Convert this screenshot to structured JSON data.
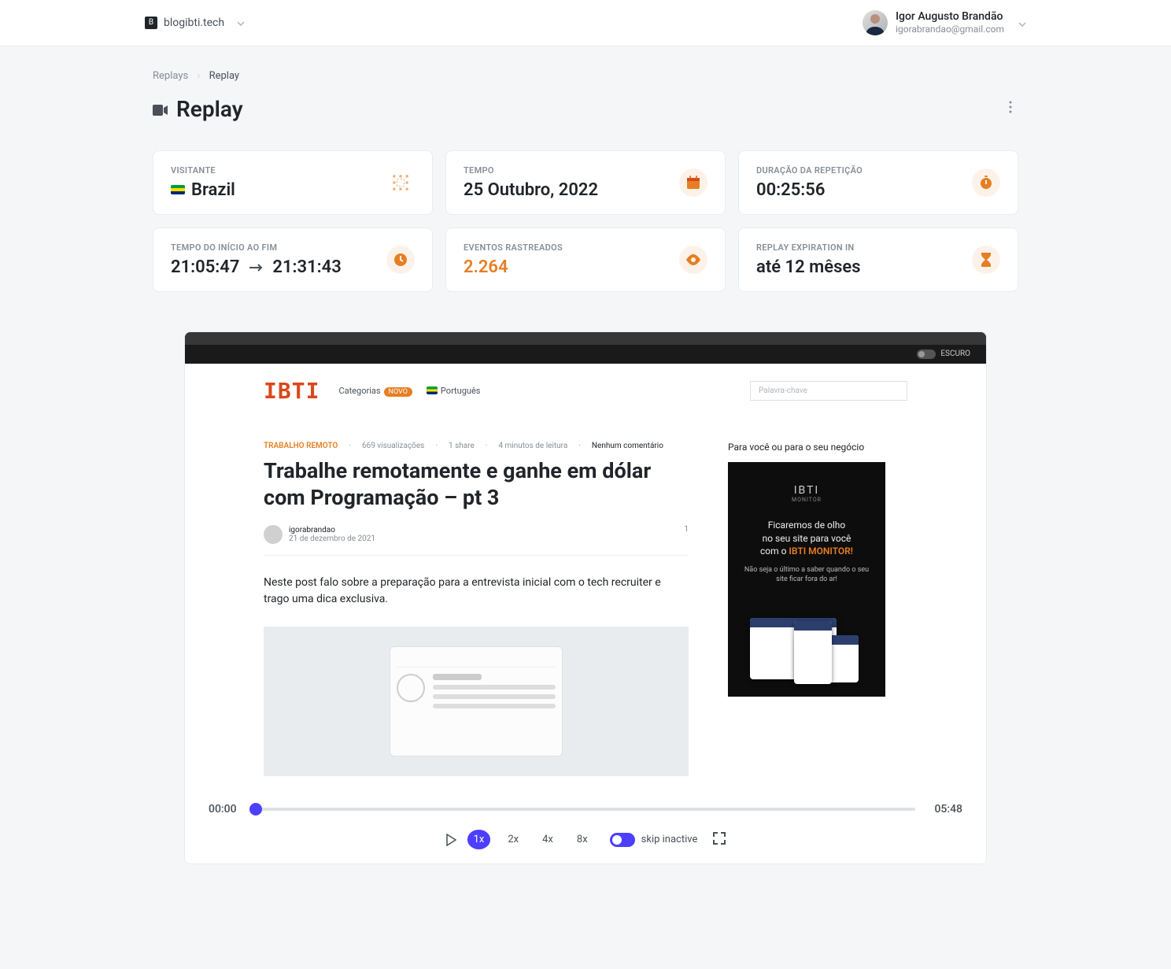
{
  "header": {
    "site_name": "blogibti.tech",
    "user_name": "Igor Augusto Brandão",
    "user_email": "igorabrandao@gmail.com"
  },
  "breadcrumbs": {
    "parent": "Replays",
    "current": "Replay"
  },
  "page": {
    "title": "Replay"
  },
  "stats": {
    "visitor": {
      "label": "VISITANTE",
      "value": "Brazil"
    },
    "time": {
      "label": "TEMPO",
      "value": "25 Outubro, 2022"
    },
    "duration": {
      "label": "DURAÇÃO DA REPETIÇÃO",
      "value": "00:25:56"
    },
    "start_end": {
      "label": "TEMPO DO INÍCIO AO FIM",
      "start": "21:05:47",
      "end": "21:31:43"
    },
    "events": {
      "label": "EVENTOS RASTREADOS",
      "value": "2.264"
    },
    "expiration": {
      "label": "REPLAY EXPIRATION IN",
      "value": "até 12 mêses"
    }
  },
  "viewport": {
    "dark_label": "ESCURO",
    "nav": {
      "categories": "Categorias",
      "badge": "NOVO",
      "language": "Português",
      "search_placeholder": "Palavra-chave"
    },
    "post": {
      "category": "TRABALHO REMOTO",
      "views": "669 visualizações",
      "shares": "1 share",
      "read_time": "4 minutos de leitura",
      "comments": "Nenhum comentário",
      "title": "Trabalhe remotamente e ganhe em dólar com Programação – pt 3",
      "author": "igorabrandao",
      "date": "21 de dezembro de 2021",
      "count": "1",
      "excerpt": "Neste post falo sobre a preparação para a entrevista inicial com o tech recruiter e trago uma dica exclusiva."
    },
    "sidebar": {
      "title": "Para você ou para o seu negócio",
      "ad_logo": "IBTI",
      "ad_sublogo": "MONITOR",
      "ad_line1_a": "Ficaremos de olho",
      "ad_line1_b": "no seu site para você",
      "ad_line1_c": "com o ",
      "ad_brand": "IBTI MONITOR!",
      "ad_line2": "Não seja o último a saber quando o seu site ficar fora do ar!"
    }
  },
  "player": {
    "current_time": "00:00",
    "total_time": "05:48",
    "speeds": [
      "1x",
      "2x",
      "4x",
      "8x"
    ],
    "skip_label": "skip inactive"
  }
}
